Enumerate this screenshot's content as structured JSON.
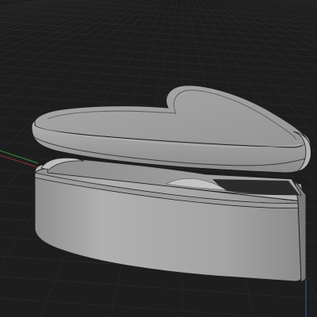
{
  "viewport": {
    "background_color": "#1d1d1e",
    "grid_color": "#2b2b2d",
    "grid_visible": true,
    "axis_x_color": "#8b2f35",
    "axis_y_color": "#3a8a3a",
    "axis_z_color": "#2f4f9a",
    "shading_mode": "solid-with-edges",
    "edge_color": "#202020"
  },
  "model": {
    "object_name": "heart-box",
    "parts": [
      "lid",
      "base"
    ],
    "lid_state": "open",
    "lid_color": "#a3a3a3",
    "lid_top_color": "#9c9c9c",
    "base_outer_color": "#a6a6a6",
    "base_inner_color": "#9a9a9a",
    "base_floor_color": "#bfbfbf",
    "cavity_shadow_color": "#2a2a2a"
  }
}
